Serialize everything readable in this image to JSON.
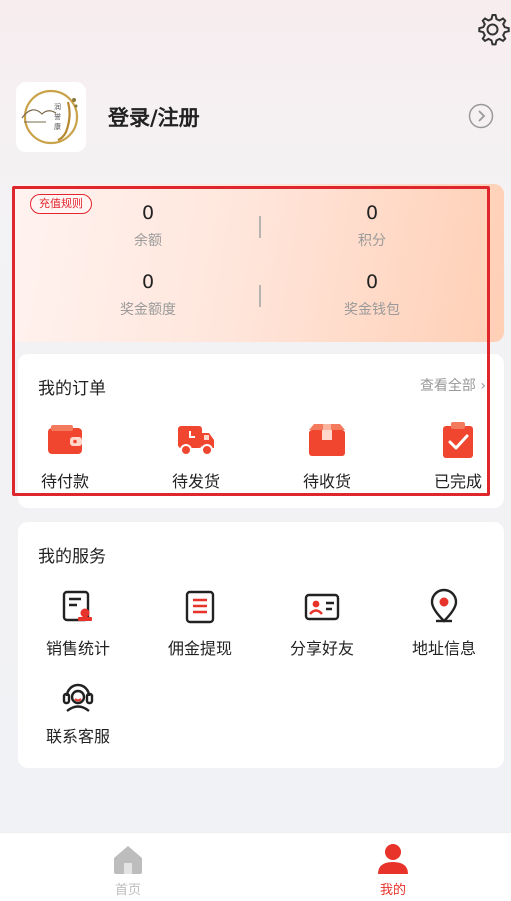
{
  "profile": {
    "login_label": "登录/注册"
  },
  "wallet": {
    "rules_badge": "充值规则",
    "stats": [
      {
        "value": "0",
        "label": "余额"
      },
      {
        "value": "0",
        "label": "积分"
      },
      {
        "value": "0",
        "label": "奖金额度"
      },
      {
        "value": "0",
        "label": "奖金钱包"
      }
    ]
  },
  "orders": {
    "title": "我的订单",
    "see_all": "查看全部",
    "items": [
      {
        "label": "待付款",
        "icon": "wallet-icon"
      },
      {
        "label": "待发货",
        "icon": "truck-icon"
      },
      {
        "label": "待收货",
        "icon": "package-icon"
      },
      {
        "label": "已完成",
        "icon": "clipboard-check-icon"
      }
    ]
  },
  "services": {
    "title": "我的服务",
    "items": [
      {
        "label": "销售统计",
        "icon": "sales-report-icon"
      },
      {
        "label": "佣金提现",
        "icon": "receipt-icon"
      },
      {
        "label": "分享好友",
        "icon": "share-card-icon"
      },
      {
        "label": "地址信息",
        "icon": "location-pin-icon"
      },
      {
        "label": "联系客服",
        "icon": "customer-service-icon"
      }
    ]
  },
  "tabbar": {
    "items": [
      {
        "label": "首页",
        "icon": "home-icon",
        "active": false
      },
      {
        "label": "我的",
        "icon": "user-icon",
        "active": true
      }
    ]
  },
  "colors": {
    "accent": "#f0452e",
    "highlight_border": "#e0262d",
    "active_tab": "#e8332b",
    "inactive_tab": "#bdbdbd"
  }
}
